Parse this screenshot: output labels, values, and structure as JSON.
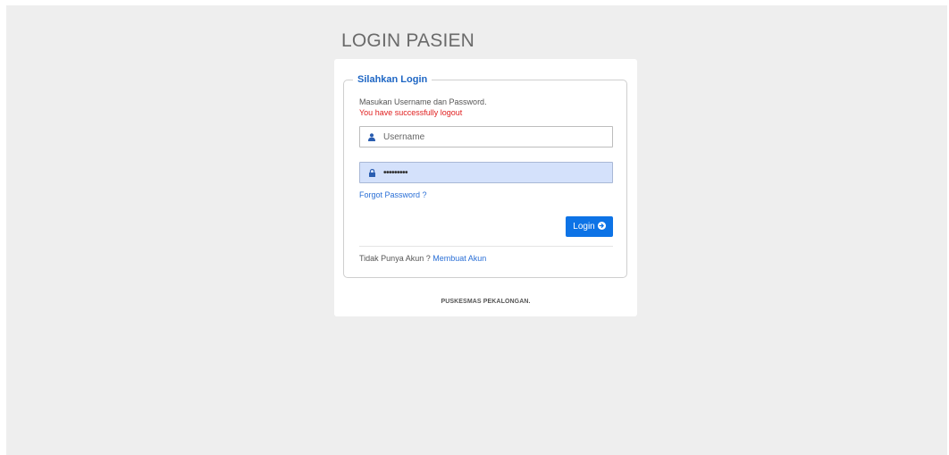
{
  "page": {
    "title": "LOGIN PASIEN"
  },
  "form": {
    "legend": "Silahkan Login",
    "help_text": "Masukan Username dan Password.",
    "logout_message": "You have successfully logout",
    "username": {
      "placeholder": "Username",
      "value": "",
      "icon": "user-icon"
    },
    "password": {
      "masked_value": "•••••••••",
      "icon": "lock-icon"
    },
    "forgot_link": "Forgot Password ?",
    "login_button": "Login",
    "login_button_icon": "arrow-circle-right-icon",
    "no_account_text": "Tidak Punya Akun ?",
    "create_account_link": "Membuat Akun"
  },
  "footer": {
    "text": "PUSKESMAS PEKALONGAN."
  },
  "colors": {
    "background": "#eeeeee",
    "card": "#ffffff",
    "accent": "#0d73e6",
    "link": "#2a6fd6",
    "legend": "#1e66c4",
    "error": "#e02020",
    "password_autofill_bg": "#d4e1fb"
  }
}
